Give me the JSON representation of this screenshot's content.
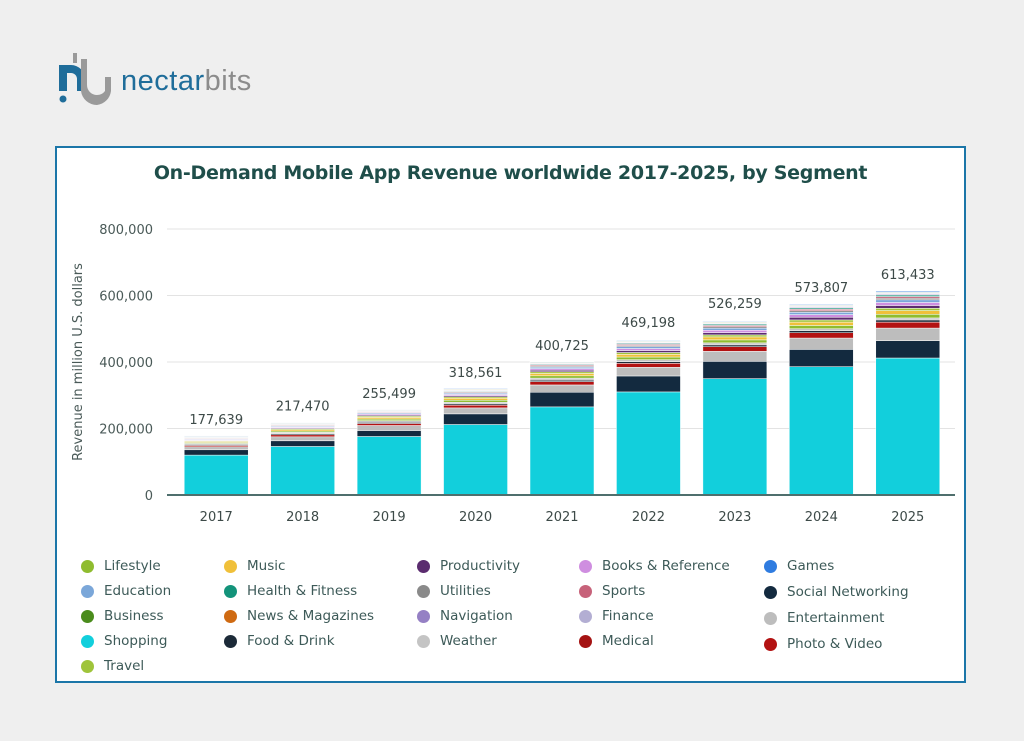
{
  "brand": {
    "name_part1": "nectar",
    "name_part2": "bits",
    "logo_icon": "nectarbits-logo-icon"
  },
  "chart_data": {
    "type": "bar",
    "stacked": true,
    "title": "On-Demand Mobile App Revenue worldwide 2017-2025, by Segment",
    "xlabel": "",
    "ylabel": "Revenue in million U.S. dollars",
    "ylim": [
      0,
      800000
    ],
    "yticks": [
      0,
      200000,
      400000,
      600000,
      800000
    ],
    "ytick_labels": [
      "0",
      "200,000",
      "400,000",
      "600,000",
      "800,000"
    ],
    "grid": true,
    "legend_position": "bottom",
    "categories": [
      "2017",
      "2018",
      "2019",
      "2020",
      "2021",
      "2022",
      "2023",
      "2024",
      "2025"
    ],
    "totals": [
      177639,
      217470,
      255499,
      318561,
      400725,
      469198,
      526259,
      573807,
      613433
    ],
    "total_labels": [
      "177,639",
      "217,470",
      "255,499",
      "318,561",
      "400,725",
      "469,198",
      "526,259",
      "573,807",
      "613,433"
    ],
    "series": [
      {
        "name": "Shopping",
        "color": "#12cfdc",
        "values": [
          120000,
          146000,
          176000,
          212000,
          265000,
          310000,
          350000,
          386000,
          412000
        ]
      },
      {
        "name": "Social Networking",
        "color": "#132a3f",
        "values": [
          16000,
          17000,
          18000,
          32000,
          44000,
          48000,
          52000,
          52000,
          52000
        ]
      },
      {
        "name": "Entertainment",
        "color": "#bdbdbd",
        "values": [
          9000,
          12000,
          15000,
          18000,
          22000,
          26000,
          30000,
          34000,
          38000
        ]
      },
      {
        "name": "Photo & Video",
        "color": "#b31212",
        "values": [
          4000,
          6000,
          6000,
          8000,
          10000,
          12000,
          14000,
          16000,
          18000
        ]
      },
      {
        "name": "Food & Drink",
        "color": "#1c2a38",
        "values": [
          3000,
          3500,
          3500,
          4000,
          4500,
          5000,
          5500,
          6000,
          6500
        ]
      },
      {
        "name": "Weather",
        "color": "#c4c4c4",
        "values": [
          3000,
          4000,
          5000,
          5000,
          6000,
          6000,
          6000,
          6000,
          6000
        ]
      },
      {
        "name": "Lifestyle",
        "color": "#8fbc2f",
        "values": [
          3000,
          4000,
          5000,
          6000,
          7000,
          8000,
          9000,
          10000,
          11000
        ]
      },
      {
        "name": "Music",
        "color": "#f0c03a",
        "values": [
          3000,
          4000,
          5000,
          6000,
          7000,
          8000,
          9000,
          10000,
          11000
        ]
      },
      {
        "name": "Travel",
        "color": "#9fc43a",
        "values": [
          2000,
          3000,
          3500,
          4000,
          5000,
          5500,
          6000,
          6500,
          7000
        ]
      },
      {
        "name": "Productivity",
        "color": "#5b2c6f",
        "values": [
          2000,
          2500,
          3000,
          4000,
          5000,
          6000,
          7000,
          8000,
          8500
        ]
      },
      {
        "name": "Books & Reference",
        "color": "#cf8ee0",
        "values": [
          2000,
          2500,
          3000,
          3500,
          4500,
          6000,
          7000,
          8000,
          9000
        ]
      },
      {
        "name": "Education",
        "color": "#7ba7d9",
        "values": [
          2000,
          2500,
          3000,
          3500,
          4500,
          5500,
          6500,
          7000,
          8000
        ]
      },
      {
        "name": "Utilities",
        "color": "#8a8a8a",
        "values": [
          1500,
          2000,
          2000,
          2500,
          3000,
          3500,
          4000,
          4500,
          5000
        ]
      },
      {
        "name": "Sports",
        "color": "#c7627a",
        "values": [
          1500,
          2000,
          2000,
          2500,
          3000,
          3500,
          4000,
          4500,
          5000
        ]
      },
      {
        "name": "Health & Fitness",
        "color": "#13937a",
        "values": [
          1500,
          1500,
          1500,
          2000,
          2500,
          3000,
          3500,
          4000,
          4500
        ]
      },
      {
        "name": "Navigation",
        "color": "#9580c4",
        "values": [
          1000,
          1000,
          1000,
          1500,
          1500,
          2000,
          2000,
          2500,
          2500
        ]
      },
      {
        "name": "Finance",
        "color": "#b3aed3",
        "values": [
          1000,
          1000,
          1000,
          1500,
          1500,
          2000,
          2000,
          2500,
          2500
        ]
      },
      {
        "name": "Medical",
        "color": "#a51313",
        "values": [
          700,
          700,
          700,
          1000,
          1000,
          1000,
          1000,
          1000,
          1000
        ]
      },
      {
        "name": "News & Magazines",
        "color": "#cf6a12",
        "values": [
          700,
          700,
          700,
          1000,
          1000,
          1000,
          1000,
          1000,
          1000
        ]
      },
      {
        "name": "Business",
        "color": "#4a8c1c",
        "values": [
          700,
          700,
          700,
          1000,
          1000,
          1000,
          1000,
          1000,
          1000
        ]
      },
      {
        "name": "Games",
        "color": "#2f7ce0",
        "values": [
          539,
          770,
          899,
          1561,
          1725,
          1698,
          1759,
          2307,
          2933
        ]
      }
    ],
    "legend": [
      {
        "name": "Lifestyle",
        "color": "#8fbc2f"
      },
      {
        "name": "Education",
        "color": "#7ba7d9"
      },
      {
        "name": "Business",
        "color": "#4a8c1c"
      },
      {
        "name": "Shopping",
        "color": "#12cfdc"
      },
      {
        "name": "Travel",
        "color": "#9fc43a"
      },
      {
        "name": "Music",
        "color": "#f0c03a"
      },
      {
        "name": "Health & Fitness",
        "color": "#13937a"
      },
      {
        "name": "News & Magazines",
        "color": "#cf6a12"
      },
      {
        "name": "Food & Drink",
        "color": "#1c2a38"
      },
      {
        "name": "Productivity",
        "color": "#5b2c6f"
      },
      {
        "name": "Utilities",
        "color": "#8a8a8a"
      },
      {
        "name": "Navigation",
        "color": "#9580c4"
      },
      {
        "name": "Weather",
        "color": "#c4c4c4"
      },
      {
        "name": "Books & Reference",
        "color": "#cf8ee0"
      },
      {
        "name": "Sports",
        "color": "#c7627a"
      },
      {
        "name": "Finance",
        "color": "#b3aed3"
      },
      {
        "name": "Medical",
        "color": "#a51313"
      },
      {
        "name": "Games",
        "color": "#2f7ce0"
      },
      {
        "name": "Social Networking",
        "color": "#132a3f"
      },
      {
        "name": "Entertainment",
        "color": "#bdbdbd"
      },
      {
        "name": "Photo & Video",
        "color": "#b31212"
      }
    ]
  }
}
